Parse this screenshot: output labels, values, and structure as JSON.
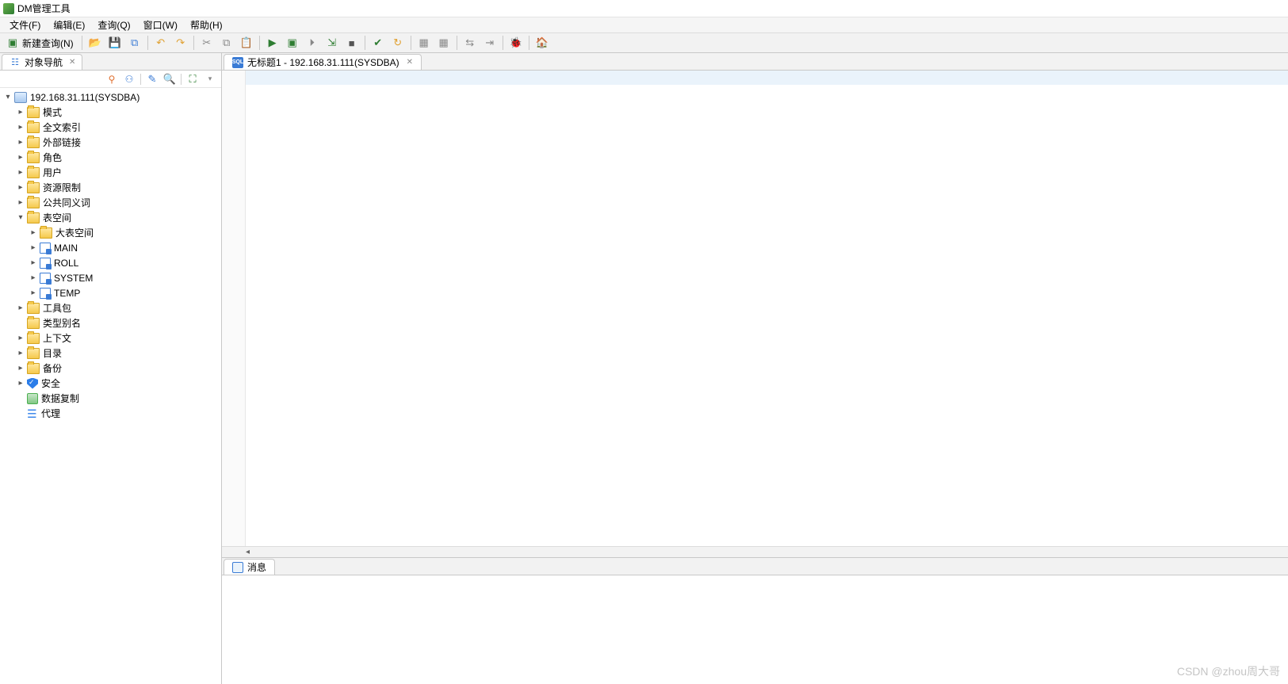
{
  "app": {
    "title": "DM管理工具"
  },
  "menu": {
    "file": "文件(F)",
    "edit": "编辑(E)",
    "query": "查询(Q)",
    "window": "窗口(W)",
    "help": "帮助(H)"
  },
  "toolbar": {
    "new_query": "新建查询(N)"
  },
  "sidebar": {
    "tab_label": "对象导航",
    "root": "192.168.31.111(SYSDBA)",
    "items": {
      "schema": "模式",
      "fulltext": "全文索引",
      "external": "外部链接",
      "roles": "角色",
      "users": "用户",
      "resource": "资源限制",
      "synonym": "公共同义词",
      "tablespace": "表空间",
      "ts_big": "大表空间",
      "ts_main": "MAIN",
      "ts_roll": "ROLL",
      "ts_system": "SYSTEM",
      "ts_temp": "TEMP",
      "toolkit": "工具包",
      "typealias": "类型别名",
      "context": "上下文",
      "catalog": "目录",
      "backup": "备份",
      "security": "安全",
      "replication": "数据复制",
      "agent": "代理"
    }
  },
  "editor": {
    "tab_title": "无标题1 - 192.168.31.111(SYSDBA)"
  },
  "messages": {
    "tab_title": "消息"
  },
  "watermark": "CSDN @zhou周大哥"
}
